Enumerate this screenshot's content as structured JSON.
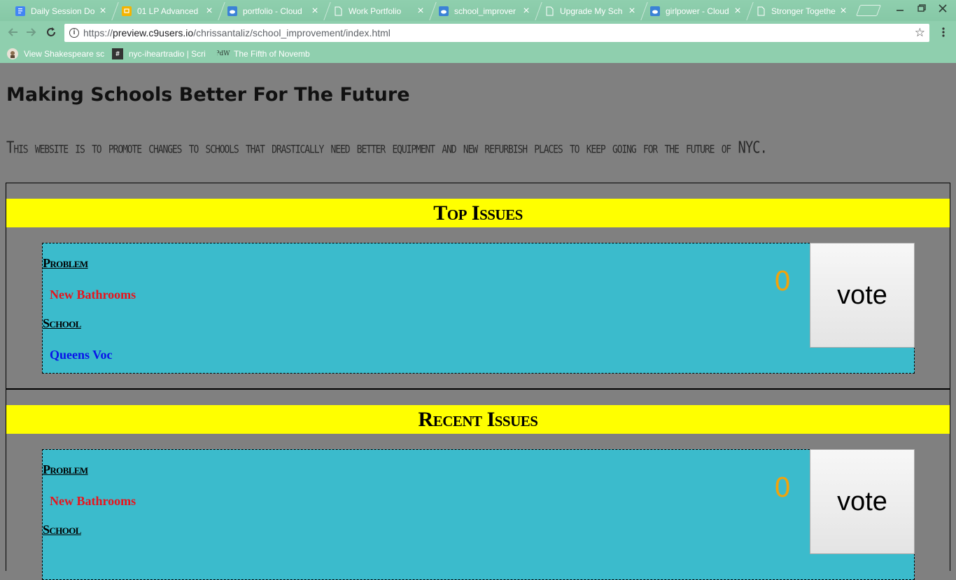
{
  "browser": {
    "tabs": [
      {
        "title": "Daily Session Do",
        "icon": "google-docs-icon",
        "color": "#4285f4"
      },
      {
        "title": "01 LP Advanced",
        "icon": "google-slides-icon",
        "color": "#f4b400"
      },
      {
        "title": "portfolio - Cloud",
        "icon": "cloud9-icon",
        "color": "#3b82d6"
      },
      {
        "title": "Work Portfolio",
        "icon": "page-icon",
        "color": "#ffffff"
      },
      {
        "title": "school_improver",
        "icon": "cloud9-icon",
        "color": "#3b82d6"
      },
      {
        "title": "Upgrade My Sch",
        "icon": "page-icon",
        "color": "#ffffff"
      },
      {
        "title": "girlpower - Cloud",
        "icon": "cloud9-icon",
        "color": "#3b82d6"
      },
      {
        "title": "Stronger Togethe",
        "icon": "page-icon",
        "color": "#ffffff"
      }
    ],
    "url": {
      "scheme": "https://",
      "host": "preview.c9users.io",
      "path": "/chrissantaliz/school_improvement/index.html"
    },
    "bookmarks": [
      {
        "title": "View Shakespeare sc",
        "icon": "shakespeare-icon"
      },
      {
        "title": "nyc-iheartradio | Scri",
        "icon": "hash-icon"
      },
      {
        "title": "The Fifth of Novemb",
        "icon": "pdw-icon"
      }
    ],
    "theme_color": "#8fcfae"
  },
  "page": {
    "title": "Making Schools Better For The Future",
    "description": "This website is to promote changes to schools that drastically need better equipment and new refurbish places to keep going for the future of NYC.",
    "background": "#808080"
  },
  "sections": [
    {
      "heading": "Top Issues",
      "issue": {
        "problem_label": "Problem",
        "problem": "New Bathrooms",
        "school_label": "School",
        "school": "Queens Voc",
        "votes": "0",
        "vote_label": "vote"
      }
    },
    {
      "heading": "Recent Issues",
      "issue": {
        "problem_label": "Problem",
        "problem": "New Bathrooms",
        "school_label": "School",
        "school": "",
        "votes": "0",
        "vote_label": "vote"
      }
    }
  ],
  "colors": {
    "section_header": "#ffff00",
    "card": "#3bbbcc",
    "problem_text": "#e8141c",
    "school_text": "#0a14e8",
    "vote_count": "#f1a30b"
  }
}
